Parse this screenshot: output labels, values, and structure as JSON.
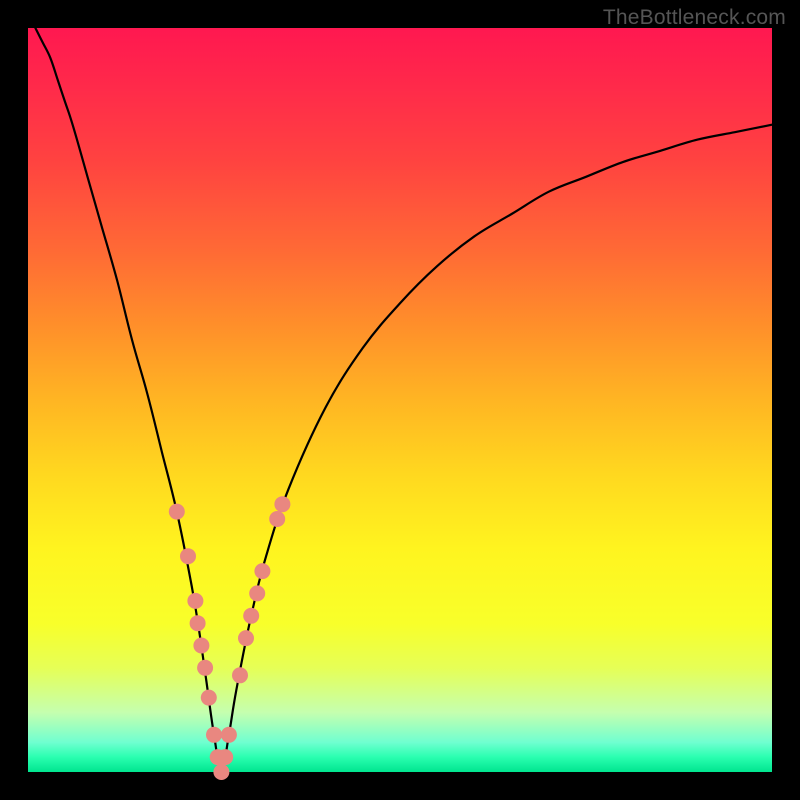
{
  "watermark": "TheBottleneck.com",
  "chart_data": {
    "type": "line",
    "title": "",
    "xlabel": "",
    "ylabel": "",
    "xlim": [
      0,
      100
    ],
    "ylim": [
      0,
      100
    ],
    "series": [
      {
        "name": "bottleneck-curve",
        "x": [
          1,
          2,
          3,
          4,
          5,
          6,
          8,
          10,
          12,
          14,
          16,
          18,
          20,
          22,
          23,
          24,
          25,
          26,
          27,
          28,
          30,
          32,
          35,
          40,
          45,
          50,
          55,
          60,
          65,
          70,
          75,
          80,
          85,
          90,
          95,
          100
        ],
        "y": [
          100,
          98,
          96,
          93,
          90,
          87,
          80,
          73,
          66,
          58,
          51,
          43,
          35,
          25,
          19,
          12,
          5,
          0,
          5,
          11,
          21,
          29,
          38,
          49,
          57,
          63,
          68,
          72,
          75,
          78,
          80,
          82,
          83.5,
          85,
          86,
          87
        ]
      }
    ],
    "markers": {
      "name": "highlight-points",
      "color": "#e98780",
      "points": [
        {
          "x": 20.0,
          "y": 35
        },
        {
          "x": 21.5,
          "y": 29
        },
        {
          "x": 22.5,
          "y": 23
        },
        {
          "x": 22.8,
          "y": 20
        },
        {
          "x": 23.3,
          "y": 17
        },
        {
          "x": 23.8,
          "y": 14
        },
        {
          "x": 24.3,
          "y": 10
        },
        {
          "x": 25.0,
          "y": 5
        },
        {
          "x": 25.5,
          "y": 2
        },
        {
          "x": 26.0,
          "y": 0
        },
        {
          "x": 26.5,
          "y": 2
        },
        {
          "x": 27.0,
          "y": 5
        },
        {
          "x": 28.5,
          "y": 13
        },
        {
          "x": 29.3,
          "y": 18
        },
        {
          "x": 30.0,
          "y": 21
        },
        {
          "x": 30.8,
          "y": 24
        },
        {
          "x": 31.5,
          "y": 27
        },
        {
          "x": 33.5,
          "y": 34
        },
        {
          "x": 34.2,
          "y": 36
        }
      ]
    }
  }
}
